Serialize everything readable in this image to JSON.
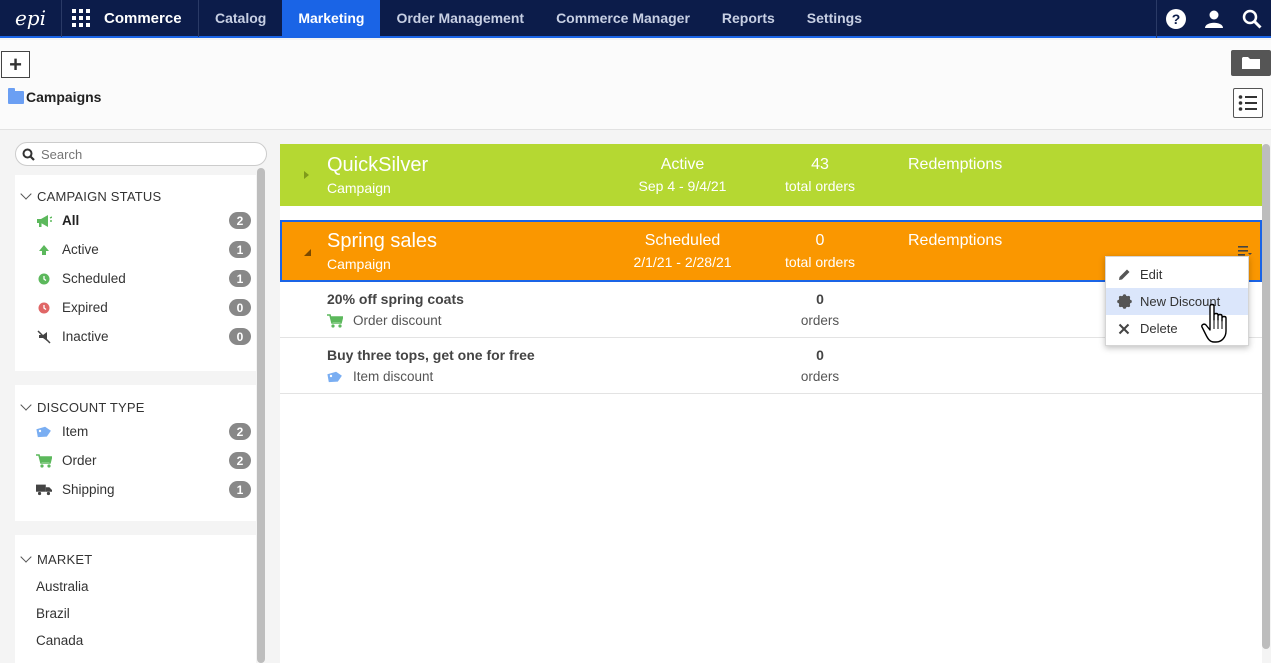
{
  "nav": {
    "logo": "epi",
    "app_name": "Commerce",
    "items": [
      {
        "label": "Catalog",
        "active": false
      },
      {
        "label": "Marketing",
        "active": true
      },
      {
        "label": "Order Management",
        "active": false
      },
      {
        "label": "Commerce Manager",
        "active": false
      },
      {
        "label": "Reports",
        "active": false
      },
      {
        "label": "Settings",
        "active": false
      }
    ],
    "right_icons": [
      "help-icon",
      "user-icon",
      "search-icon"
    ]
  },
  "toolbar": {
    "add_label": "+",
    "breadcrumb": "Campaigns"
  },
  "sidebar": {
    "search_placeholder": "Search",
    "campaign_status": {
      "title": "CAMPAIGN STATUS",
      "items": [
        {
          "label": "All",
          "count": "2",
          "icon": "megaphone-icon",
          "selected": true
        },
        {
          "label": "Active",
          "count": "1",
          "icon": "arrow-up-icon"
        },
        {
          "label": "Scheduled",
          "count": "1",
          "icon": "clock-icon"
        },
        {
          "label": "Expired",
          "count": "0",
          "icon": "clock-expired-icon"
        },
        {
          "label": "Inactive",
          "count": "0",
          "icon": "inactive-icon"
        }
      ]
    },
    "discount_type": {
      "title": "DISCOUNT TYPE",
      "items": [
        {
          "label": "Item",
          "count": "2",
          "icon": "tag-icon"
        },
        {
          "label": "Order",
          "count": "2",
          "icon": "cart-icon"
        },
        {
          "label": "Shipping",
          "count": "1",
          "icon": "truck-icon"
        }
      ]
    },
    "market": {
      "title": "MARKET",
      "items": [
        "Australia",
        "Brazil",
        "Canada"
      ]
    }
  },
  "campaigns": [
    {
      "name": "QuickSilver",
      "type": "Campaign",
      "status": "Active",
      "dates": "Sep 4 - 9/4/21",
      "orders": "43",
      "orders_label": "total orders",
      "redemptions": "Redemptions",
      "color": "#b5d832"
    },
    {
      "name": "Spring sales",
      "type": "Campaign",
      "status": "Scheduled",
      "dates": "2/1/21 - 2/28/21",
      "orders": "0",
      "orders_label": "total orders",
      "redemptions": "Redemptions",
      "color": "#fa9700"
    }
  ],
  "discounts": [
    {
      "name": "20% off spring coats",
      "type": "Order discount",
      "icon": "cart-icon",
      "orders": "0",
      "orders_label": "orders"
    },
    {
      "name": "Buy three tops, get one for free",
      "type": "Item discount",
      "icon": "tag-icon",
      "orders": "0",
      "orders_label": "orders"
    }
  ],
  "context_menu": {
    "items": [
      {
        "label": "Edit",
        "icon": "pencil-icon"
      },
      {
        "label": "New Discount",
        "icon": "discount-badge-icon",
        "hover": true
      },
      {
        "label": "Delete",
        "icon": "x-icon"
      }
    ]
  },
  "colors": {
    "nav_bg": "#0c1c4a",
    "accent": "#1a64e6",
    "active_campaign": "#b5d832",
    "scheduled_campaign": "#fa9700",
    "selected_border": "#1a64e6"
  }
}
